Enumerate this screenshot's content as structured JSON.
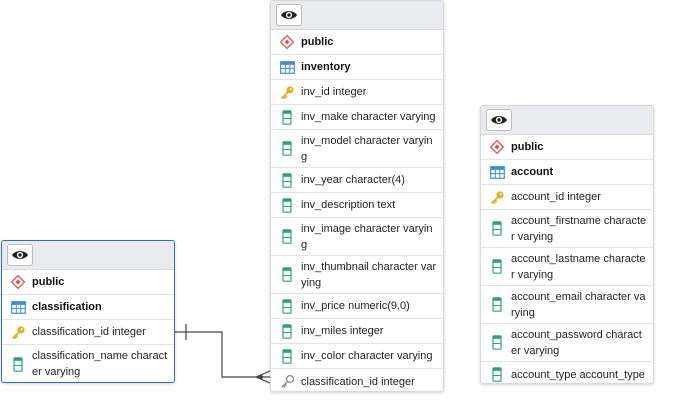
{
  "tables": {
    "classification": {
      "rows": [
        {
          "icon": "schema-icon",
          "text": "public"
        },
        {
          "icon": "table-icon",
          "text": "classification"
        },
        {
          "icon": "primary-key-icon",
          "text": "classification_id integer"
        },
        {
          "icon": "column-icon",
          "text": "classification_name character varying"
        }
      ]
    },
    "inventory": {
      "rows": [
        {
          "icon": "schema-icon",
          "text": "public"
        },
        {
          "icon": "table-icon",
          "text": "inventory"
        },
        {
          "icon": "primary-key-icon",
          "text": "inv_id integer"
        },
        {
          "icon": "column-icon",
          "text": "inv_make character varying"
        },
        {
          "icon": "column-icon",
          "text": "inv_model character varying"
        },
        {
          "icon": "column-icon",
          "text": "inv_year character(4)"
        },
        {
          "icon": "column-icon",
          "text": "inv_description text"
        },
        {
          "icon": "column-icon",
          "text": "inv_image character varying"
        },
        {
          "icon": "column-icon",
          "text": "inv_thumbnail character varying"
        },
        {
          "icon": "column-icon",
          "text": "inv_price numeric(9,0)"
        },
        {
          "icon": "column-icon",
          "text": "inv_miles integer"
        },
        {
          "icon": "column-icon",
          "text": "inv_color character varying"
        },
        {
          "icon": "foreign-key-icon",
          "text": "classification_id integer"
        }
      ]
    },
    "account": {
      "rows": [
        {
          "icon": "schema-icon",
          "text": "public"
        },
        {
          "icon": "table-icon",
          "text": "account"
        },
        {
          "icon": "primary-key-icon",
          "text": "account_id integer"
        },
        {
          "icon": "column-icon",
          "text": "account_firstname character varying"
        },
        {
          "icon": "column-icon",
          "text": "account_lastname character varying"
        },
        {
          "icon": "column-icon",
          "text": "account_email character varying"
        },
        {
          "icon": "column-icon",
          "text": "account_password character varying"
        },
        {
          "icon": "column-icon",
          "text": "account_type account_type"
        }
      ]
    }
  },
  "colors": {
    "schema": "#d9534f",
    "table": "#3c8fd6",
    "key": "#e0b21c",
    "column": "#2aa37a",
    "selected_border": "#2e6ec2",
    "relationship_line": "#444444"
  }
}
